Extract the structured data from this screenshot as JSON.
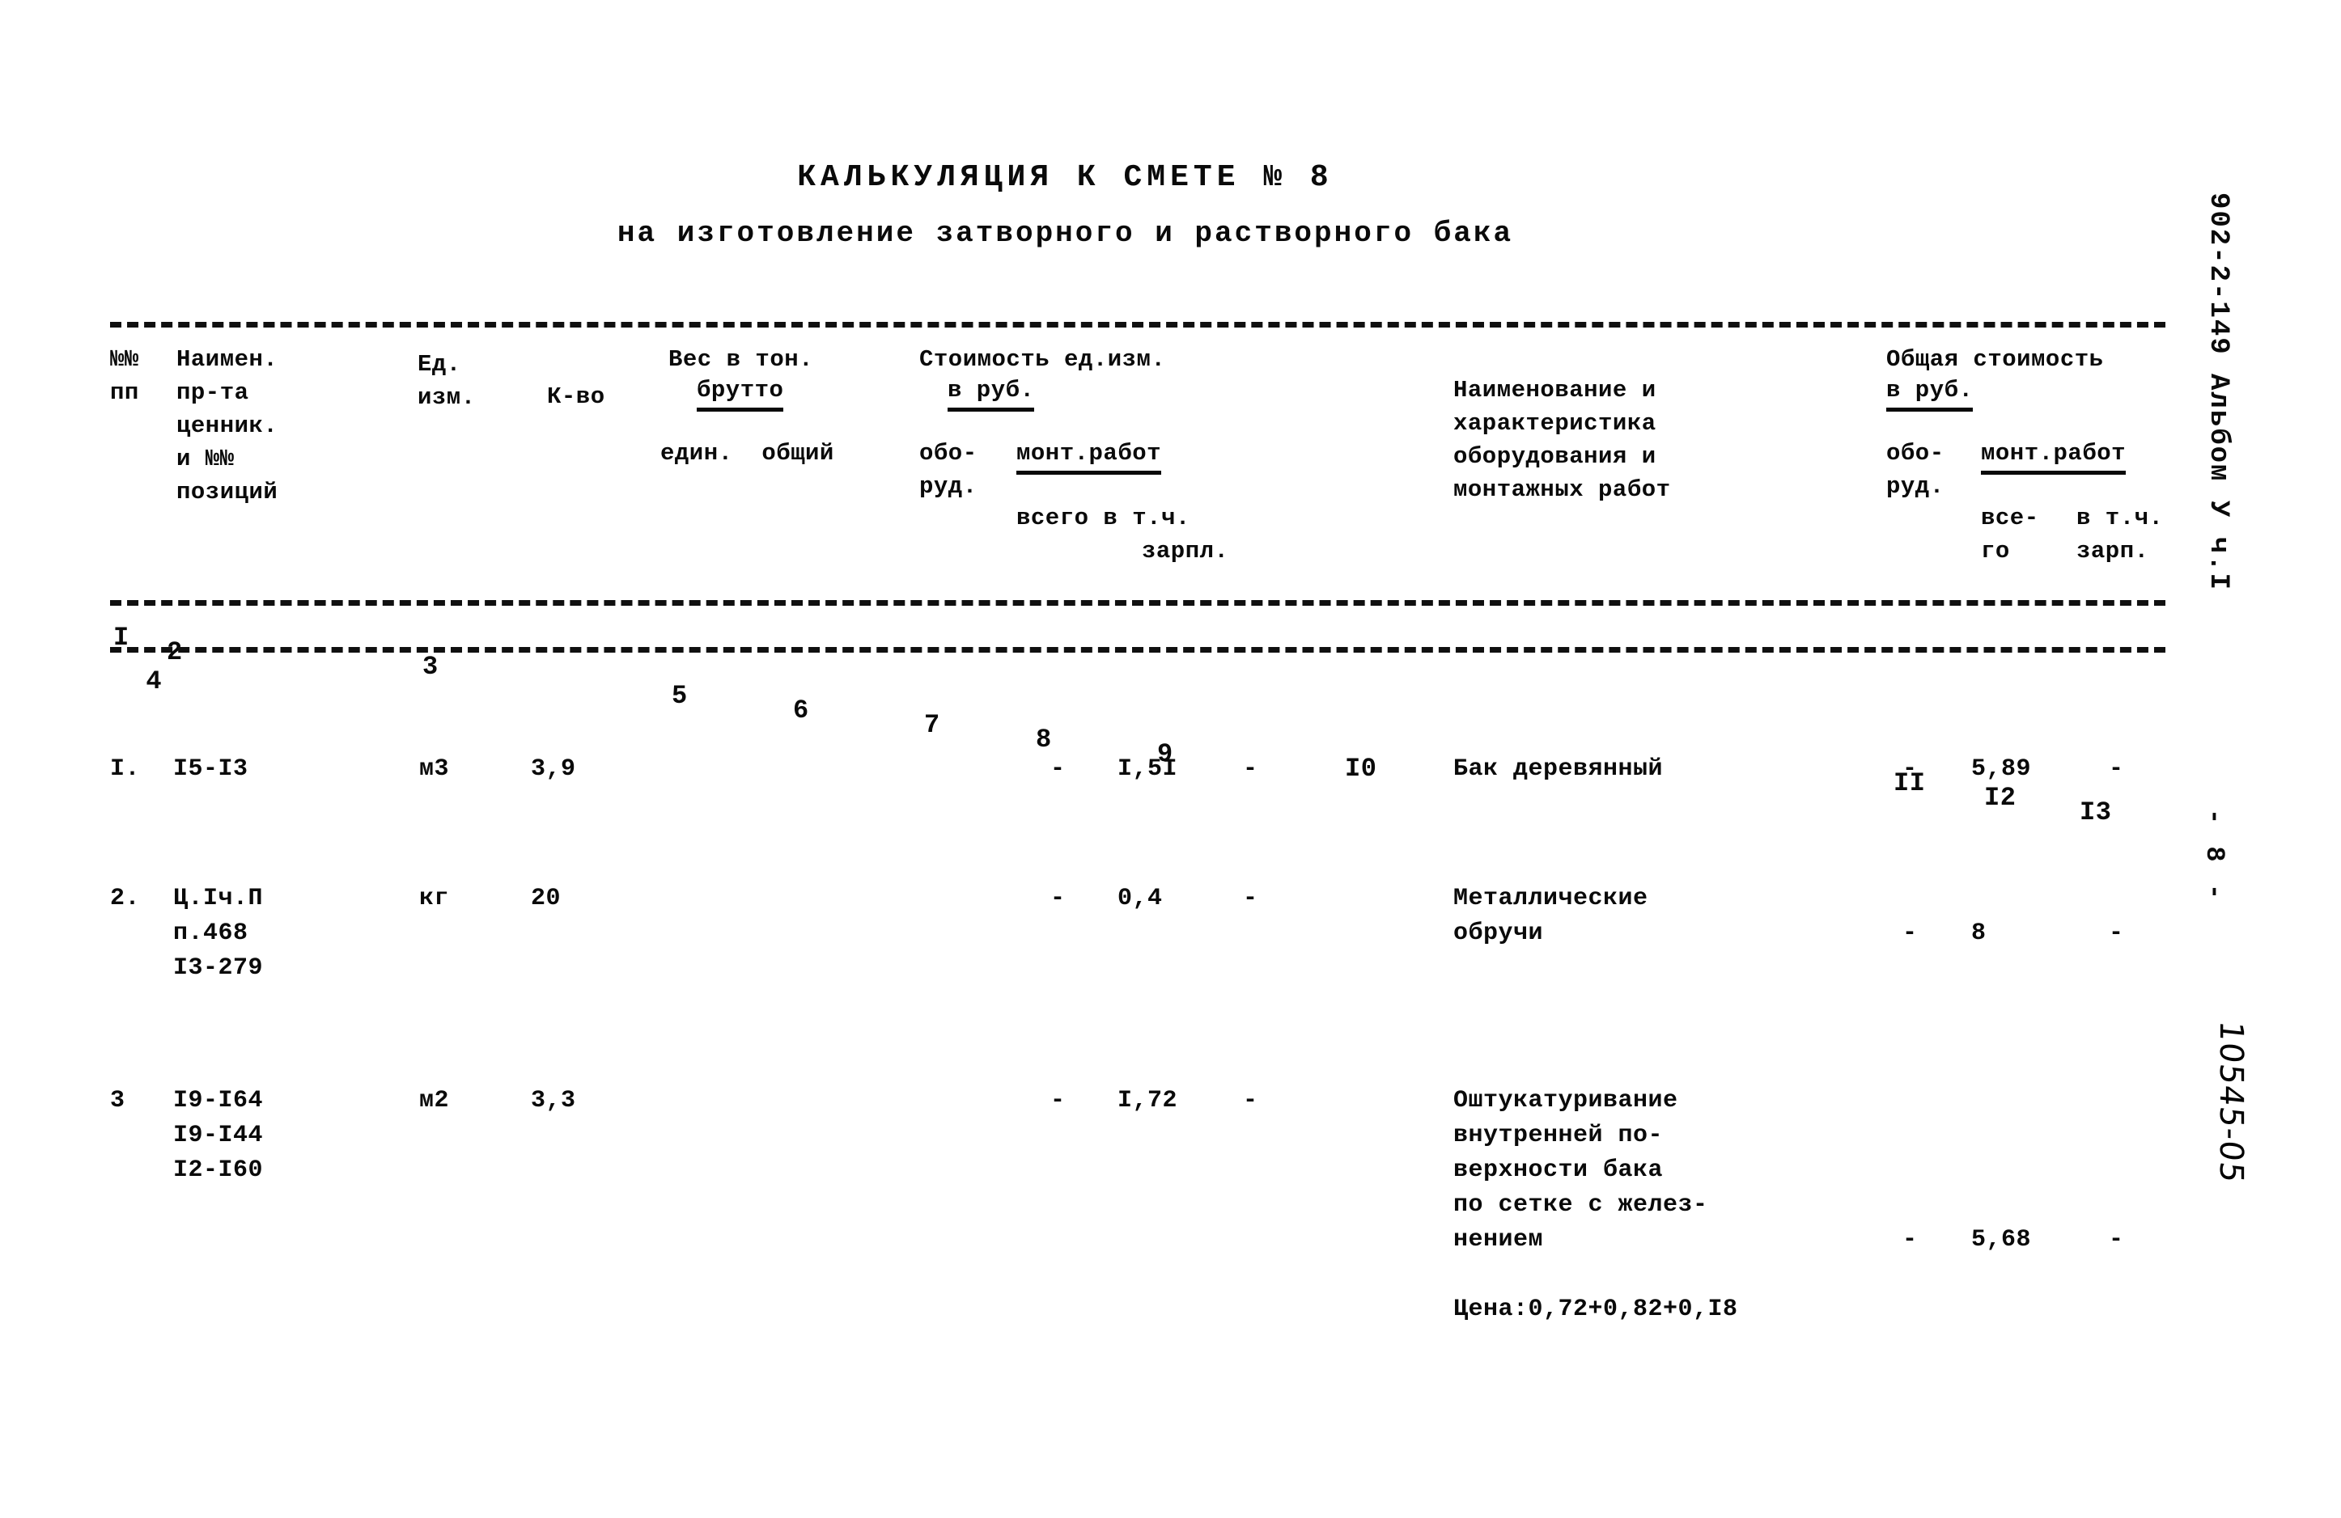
{
  "document": {
    "title": "КАЛЬКУЛЯЦИЯ К СМЕТЕ № 8",
    "subtitle": "на изготовление затворного и растворного бака",
    "margin_code": "902-2-149 Альбом У ч.I",
    "page_number": "- 8 -",
    "hand_note": "10545-05"
  },
  "table": {
    "header": {
      "col_nn": "№№\nпп",
      "col_name": "Наимен.\nпр-та\nценник.\nи №№\nпозиций",
      "col_unit": "Ед.\nизм.",
      "col_qty": "К-во",
      "col_weight_title": "Вес в тон.",
      "col_weight_brutto": "брутто",
      "col_weight_sub": "един.  общий",
      "col_cost_title": "Стоимость ед.изм.",
      "col_cost_rub": "в руб.",
      "col_cost_obo": "обо-\nруд.",
      "col_cost_mont": "монт.работ",
      "col_cost_vsego": "всего в т.ч.",
      "col_cost_zarpl": "зарпл.",
      "col_desc": "Наименование и\nхарактеристика\nоборудования и\nмонтажных работ",
      "col_total_title": "Общая стоимость",
      "col_total_rub": "в руб.",
      "col_total_obo": "обо-\nруд.",
      "col_total_mont": "монт.работ",
      "col_total_vsego": "все-\nго",
      "col_total_zarp": "в т.ч.\nзарп."
    },
    "column_numbers": [
      "I",
      "2",
      "3",
      "4",
      "5",
      "6",
      "7",
      "8",
      "9",
      "I0",
      "II",
      "I2",
      "I3"
    ],
    "rows": [
      {
        "no": "I.",
        "code": "I5-I3",
        "unit": "м3",
        "qty": "3,9",
        "dash7": "-",
        "cost8": "I,5I",
        "dash9": "-",
        "description": "Бак деревянный",
        "dash11": "-",
        "total12": "5,89",
        "dash13": "-"
      },
      {
        "no": "2.",
        "code": "Ц.Iч.П\nп.468\nI3-279",
        "unit": "кг",
        "qty": "20",
        "dash7": "-",
        "cost8": "0,4",
        "dash9": "-",
        "description": "Металлические\nобручи",
        "dash11": "-",
        "total12": "8",
        "dash13": "-"
      },
      {
        "no": "3",
        "code": "I9-I64\nI9-I44\nI2-I60",
        "unit": "м2",
        "qty": "3,3",
        "dash7": "-",
        "cost8": "I,72",
        "dash9": "-",
        "description": "Оштукатуривание\nвнутренней по-\nверхности бака\nпо сетке с желез-\nнением\n\nЦена:0,72+0,82+0,I8",
        "dash11": "-",
        "total12": "5,68",
        "dash13": "-"
      }
    ]
  }
}
